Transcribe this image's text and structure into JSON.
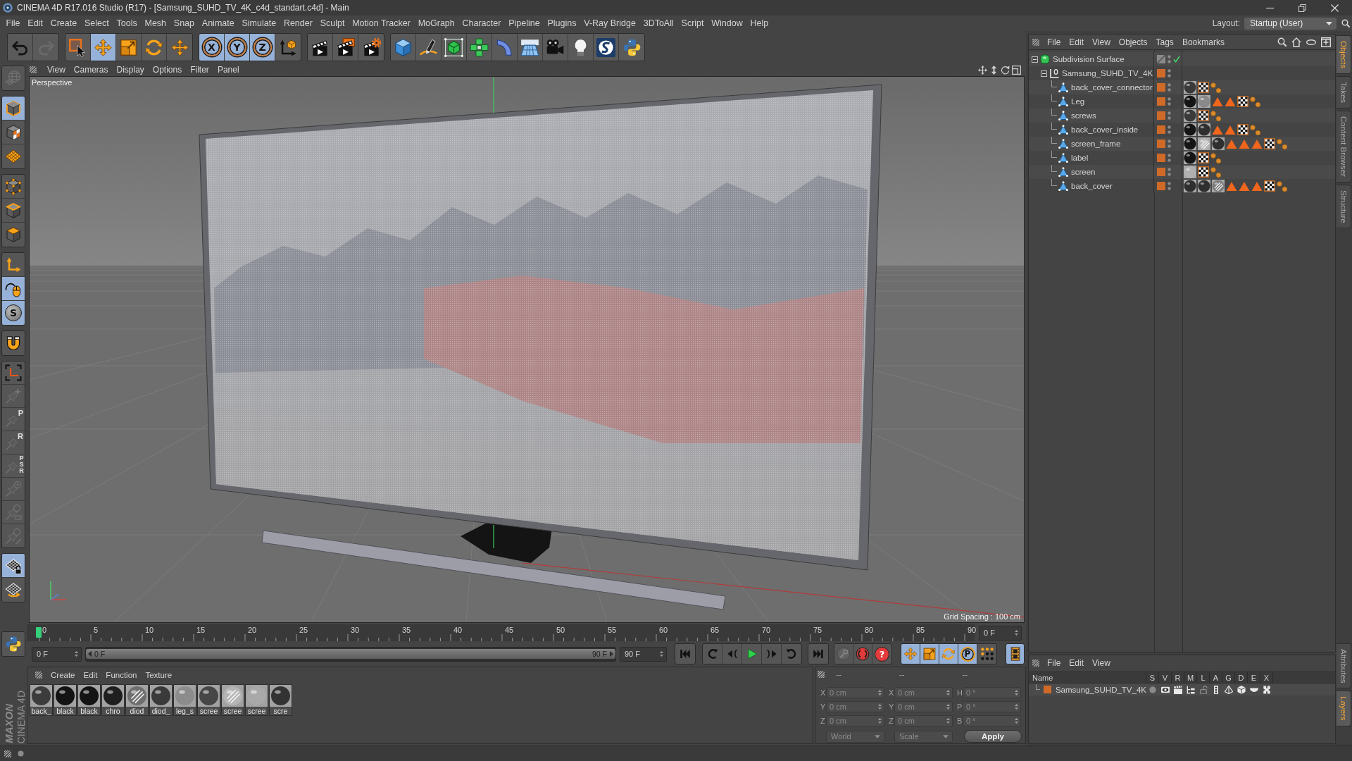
{
  "window": {
    "title": "CINEMA 4D R17.016 Studio (R17) - [Samsung_SUHD_TV_4K_c4d_standart.c4d] - Main"
  },
  "menu_bar": [
    "File",
    "Edit",
    "Create",
    "Select",
    "Tools",
    "Mesh",
    "Snap",
    "Animate",
    "Simulate",
    "Render",
    "Sculpt",
    "Motion Tracker",
    "MoGraph",
    "Character",
    "Pipeline",
    "Plugins",
    "V-Ray Bridge",
    "3DToAll",
    "Script",
    "Window",
    "Help"
  ],
  "layout": {
    "label": "Layout:",
    "value": "Startup (User)"
  },
  "toolbar": {
    "groups": [
      {
        "tools": [
          {
            "kind": "undo",
            "selected": false,
            "disabled": false
          },
          {
            "kind": "redo",
            "selected": false,
            "disabled": true
          }
        ]
      },
      {
        "tools": [
          {
            "kind": "live_select",
            "selected": false,
            "disabled": false
          },
          {
            "kind": "move",
            "selected": true,
            "disabled": false
          },
          {
            "kind": "scale",
            "selected": false,
            "disabled": false
          },
          {
            "kind": "rotate",
            "selected": false,
            "disabled": false
          },
          {
            "kind": "last_tool",
            "selected": false,
            "disabled": false
          }
        ]
      },
      {
        "tools": [
          {
            "kind": "axis",
            "label": "X",
            "selected": true,
            "disabled": false
          },
          {
            "kind": "axis",
            "label": "Y",
            "selected": true,
            "disabled": false
          },
          {
            "kind": "axis",
            "label": "Z",
            "selected": true,
            "disabled": false
          },
          {
            "kind": "coordinate_system",
            "selected": false,
            "disabled": false
          }
        ]
      },
      {
        "tools": [
          {
            "kind": "render_view",
            "selected": false,
            "disabled": false
          },
          {
            "kind": "render_picture",
            "selected": false,
            "disabled": false
          },
          {
            "kind": "render_settings",
            "selected": false,
            "disabled": false
          }
        ]
      },
      {
        "tools": [
          {
            "kind": "cube",
            "selected": false,
            "disabled": false
          },
          {
            "kind": "pen",
            "selected": false,
            "disabled": false
          },
          {
            "kind": "subdivision",
            "selected": false,
            "disabled": false
          },
          {
            "kind": "cloner",
            "selected": false,
            "disabled": false
          },
          {
            "kind": "deformer",
            "selected": false,
            "disabled": false
          },
          {
            "kind": "floor",
            "selected": false,
            "disabled": false
          },
          {
            "kind": "camera",
            "selected": false,
            "disabled": false
          },
          {
            "kind": "light",
            "selected": false,
            "disabled": false
          },
          {
            "kind": "sketch",
            "selected": false,
            "disabled": false
          },
          {
            "kind": "python",
            "selected": false,
            "disabled": false
          }
        ]
      }
    ]
  },
  "left_toolbar": {
    "groups": [
      {
        "tools": [
          {
            "kind": "globe",
            "selected": false,
            "disabled": true
          }
        ]
      },
      {
        "tools": [
          {
            "kind": "model",
            "selected": true,
            "disabled": false
          },
          {
            "kind": "texture",
            "selected": false,
            "disabled": false
          },
          {
            "kind": "workplane",
            "selected": false,
            "disabled": false
          }
        ]
      },
      {
        "tools": [
          {
            "kind": "points",
            "selected": false,
            "disabled": false
          },
          {
            "kind": "edges",
            "selected": false,
            "disabled": false
          },
          {
            "kind": "polygons",
            "selected": false,
            "disabled": false
          }
        ]
      },
      {
        "tools": [
          {
            "kind": "axis_mode",
            "selected": false,
            "disabled": false
          },
          {
            "kind": "tweak",
            "selected": true,
            "disabled": false
          },
          {
            "kind": "soft",
            "label": "S",
            "selected": true,
            "disabled": false
          }
        ]
      },
      {
        "tools": [
          {
            "kind": "magnet",
            "selected": false,
            "disabled": false
          }
        ]
      },
      {
        "tools": [
          {
            "kind": "axis_corners",
            "selected": false,
            "disabled": false
          },
          {
            "kind": "pin_add",
            "selected": false,
            "disabled": true
          },
          {
            "kind": "pin_p",
            "label": "P",
            "selected": false,
            "disabled": true
          },
          {
            "kind": "pin_r",
            "label": "R",
            "selected": false,
            "disabled": true
          },
          {
            "kind": "pin_psr",
            "label": "PSR",
            "selected": false,
            "disabled": true
          },
          {
            "kind": "pin_target",
            "selected": false,
            "disabled": true
          },
          {
            "kind": "pin_square",
            "selected": false,
            "disabled": true
          },
          {
            "kind": "pin_edit",
            "selected": false,
            "disabled": true
          }
        ]
      },
      {
        "tools": [
          {
            "kind": "grid_lock",
            "selected": true,
            "disabled": false
          },
          {
            "kind": "grid_rotate",
            "selected": false,
            "disabled": false
          }
        ]
      },
      {
        "tools": [
          {
            "kind": "python",
            "selected": false,
            "disabled": false
          }
        ]
      }
    ]
  },
  "viewport": {
    "menu": [
      "View",
      "Cameras",
      "Display",
      "Options",
      "Filter",
      "Panel"
    ],
    "camera": "Perspective",
    "grid_spacing": "Grid Spacing : 100 cm"
  },
  "timeline": {
    "ticks": [
      "0",
      "5",
      "10",
      "15",
      "20",
      "25",
      "30",
      "35",
      "40",
      "45",
      "50",
      "55",
      "60",
      "65",
      "70",
      "75",
      "80",
      "85",
      "90"
    ],
    "level": 0,
    "frame_field": "0 F",
    "start_field": "0 F",
    "range": {
      "start": "0 F",
      "end": "90 F",
      "level": 1
    },
    "end_field": "90 F",
    "transport": [
      {
        "kind": "first_frame"
      },
      {
        "kind": "previous_key"
      },
      {
        "kind": "previous_frame"
      },
      {
        "kind": "play"
      },
      {
        "kind": "next_frame"
      },
      {
        "kind": "next_key"
      },
      {
        "kind": "last_frame"
      }
    ],
    "key_tools": [
      {
        "kind": "record_objects",
        "disabled": true
      },
      {
        "kind": "autokey",
        "disabled": false
      },
      {
        "kind": "keyframe_selection",
        "label": "?",
        "disabled": false
      }
    ],
    "tracks": [
      {
        "kind": "position_key",
        "selected": true
      },
      {
        "kind": "scale_key",
        "selected": true
      },
      {
        "kind": "rotation_key",
        "selected": true
      },
      {
        "kind": "parameter_key",
        "label": "P",
        "selected": true
      },
      {
        "kind": "point_key",
        "selected": false
      }
    ],
    "timeline_button": {
      "selected": true
    }
  },
  "materials": {
    "menu": [
      "Create",
      "Edit",
      "Function",
      "Texture"
    ],
    "items": [
      {
        "name": "back_",
        "kind": "plain",
        "color": "#3c3c3c"
      },
      {
        "name": "black",
        "kind": "plain",
        "color": "#141414"
      },
      {
        "name": "black",
        "kind": "plain",
        "color": "#141414"
      },
      {
        "name": "chro",
        "kind": "plain",
        "color": "#1e1e1e"
      },
      {
        "name": "diod",
        "kind": "striped",
        "color": "#6e6e6e"
      },
      {
        "name": "diod_",
        "kind": "plain",
        "color": "#3a3a3a"
      },
      {
        "name": "leg_s",
        "kind": "plain",
        "color": "#8c8c8c"
      },
      {
        "name": "scree",
        "kind": "plain",
        "color": "#464646"
      },
      {
        "name": "scree",
        "kind": "striped",
        "color": "#b4b4b4"
      },
      {
        "name": "scree",
        "kind": "plain",
        "color": "#a9a9a9"
      },
      {
        "name": "scre",
        "kind": "plain",
        "color": "#333333"
      }
    ]
  },
  "coordinates": {
    "headers": [
      "--",
      "--",
      "--"
    ],
    "rows": [
      {
        "fields": [
          {
            "axis": "X",
            "value": "0 cm"
          },
          {
            "axis": "X",
            "value": "0 cm"
          },
          {
            "axis": "H",
            "value": "0 °"
          }
        ]
      },
      {
        "fields": [
          {
            "axis": "Y",
            "value": "0 cm"
          },
          {
            "axis": "Y",
            "value": "0 cm"
          },
          {
            "axis": "P",
            "value": "0 °"
          }
        ]
      },
      {
        "fields": [
          {
            "axis": "Z",
            "value": "0 cm"
          },
          {
            "axis": "Z",
            "value": "0 cm"
          },
          {
            "axis": "B",
            "value": "0 °"
          }
        ]
      }
    ],
    "dropdowns": [
      "World",
      "Scale"
    ],
    "apply": "Apply"
  },
  "objects": {
    "menu": [
      "File",
      "Edit",
      "View",
      "Objects",
      "Tags",
      "Bookmarks"
    ],
    "tree": [
      {
        "name": "Subdivision Surface",
        "kind": "subdivision",
        "layer": false,
        "enabled": true,
        "expanded": true,
        "children": [
          {
            "name": "Samsung_SUHD_TV_4K",
            "kind": "null",
            "layer": true,
            "enabled": false,
            "expanded": true,
            "children": [
              {
                "name": "back_cover_connector",
                "kind": "polygon",
                "layer": true,
                "enabled": false,
                "tags": [
                  {
                    "kind": "material",
                    "color": "#3a3a3a"
                  },
                  {
                    "kind": "uvw"
                  },
                  {
                    "kind": "phong"
                  }
                ]
              },
              {
                "name": "Leg",
                "kind": "polygon",
                "layer": true,
                "enabled": false,
                "tags": [
                  {
                    "kind": "material",
                    "color": "#151515"
                  },
                  {
                    "kind": "material",
                    "color": "#8a8a8a"
                  },
                  {
                    "kind": "selection"
                  },
                  {
                    "kind": "selection"
                  },
                  {
                    "kind": "uvw"
                  },
                  {
                    "kind": "phong"
                  }
                ]
              },
              {
                "name": "screws",
                "kind": "polygon",
                "layer": true,
                "enabled": false,
                "tags": [
                  {
                    "kind": "material",
                    "color": "#3a3a3a"
                  },
                  {
                    "kind": "uvw"
                  },
                  {
                    "kind": "phong"
                  }
                ]
              },
              {
                "name": "back_cover_inside",
                "kind": "polygon",
                "layer": true,
                "enabled": false,
                "tags": [
                  {
                    "kind": "material",
                    "color": "#151515"
                  },
                  {
                    "kind": "material",
                    "color": "#2f2f2f"
                  },
                  {
                    "kind": "selection"
                  },
                  {
                    "kind": "selection"
                  },
                  {
                    "kind": "uvw"
                  },
                  {
                    "kind": "phong"
                  }
                ]
              },
              {
                "name": "screen_frame",
                "kind": "polygon",
                "layer": true,
                "enabled": false,
                "tags": [
                  {
                    "kind": "material",
                    "color": "#151515"
                  },
                  {
                    "kind": "striped_material",
                    "color": "#b6b6b6"
                  },
                  {
                    "kind": "material",
                    "color": "#2f2f2f"
                  },
                  {
                    "kind": "selection"
                  },
                  {
                    "kind": "selection"
                  },
                  {
                    "kind": "selection"
                  },
                  {
                    "kind": "uvw"
                  },
                  {
                    "kind": "phong"
                  }
                ]
              },
              {
                "name": "label",
                "kind": "polygon",
                "layer": true,
                "enabled": false,
                "tags": [
                  {
                    "kind": "material",
                    "color": "#151515"
                  },
                  {
                    "kind": "uvw"
                  },
                  {
                    "kind": "phong"
                  }
                ]
              },
              {
                "name": "screen",
                "kind": "polygon",
                "layer": true,
                "enabled": false,
                "tags": [
                  {
                    "kind": "material",
                    "color": "#b0b0b0"
                  },
                  {
                    "kind": "uvw"
                  },
                  {
                    "kind": "phong"
                  }
                ]
              },
              {
                "name": "back_cover",
                "kind": "polygon",
                "layer": true,
                "enabled": false,
                "tags": [
                  {
                    "kind": "material",
                    "color": "#2f2f2f"
                  },
                  {
                    "kind": "material",
                    "color": "#2f2f2f"
                  },
                  {
                    "kind": "striped_material",
                    "color": "#7a7a7a"
                  },
                  {
                    "kind": "selection"
                  },
                  {
                    "kind": "selection"
                  },
                  {
                    "kind": "selection"
                  },
                  {
                    "kind": "uvw"
                  },
                  {
                    "kind": "phong"
                  }
                ]
              }
            ]
          }
        ]
      }
    ]
  },
  "layers": {
    "menu": [
      "File",
      "Edit",
      "View"
    ],
    "columns": [
      "Name",
      "S",
      "V",
      "R",
      "M",
      "L",
      "A",
      "G",
      "D",
      "E",
      "X"
    ],
    "rows": [
      {
        "name": "Samsung_SUHD_TV_4K",
        "toggles": [
          {
            "kind": "solo",
            "on": false
          },
          {
            "kind": "visible",
            "on": true
          },
          {
            "kind": "render",
            "on": true
          },
          {
            "kind": "manager",
            "on": true
          },
          {
            "kind": "locked",
            "on": false
          },
          {
            "kind": "animation",
            "on": true
          },
          {
            "kind": "generators",
            "on": true
          },
          {
            "kind": "deformers",
            "on": true
          },
          {
            "kind": "expressions",
            "on": true
          },
          {
            "kind": "xrefs",
            "on": true
          }
        ]
      }
    ]
  },
  "side_tabs": {
    "top": [
      {
        "label": "Objects",
        "selected": true
      },
      {
        "label": "Takes",
        "selected": false
      },
      {
        "label": "Content Browser",
        "selected": false
      },
      {
        "label": "Structure",
        "selected": false
      }
    ],
    "bottom": [
      {
        "label": "Attributes",
        "selected": false
      },
      {
        "label": "Layers",
        "selected": true
      }
    ]
  },
  "branding": {
    "company": "MAXON",
    "product": "CINEMA 4D"
  }
}
